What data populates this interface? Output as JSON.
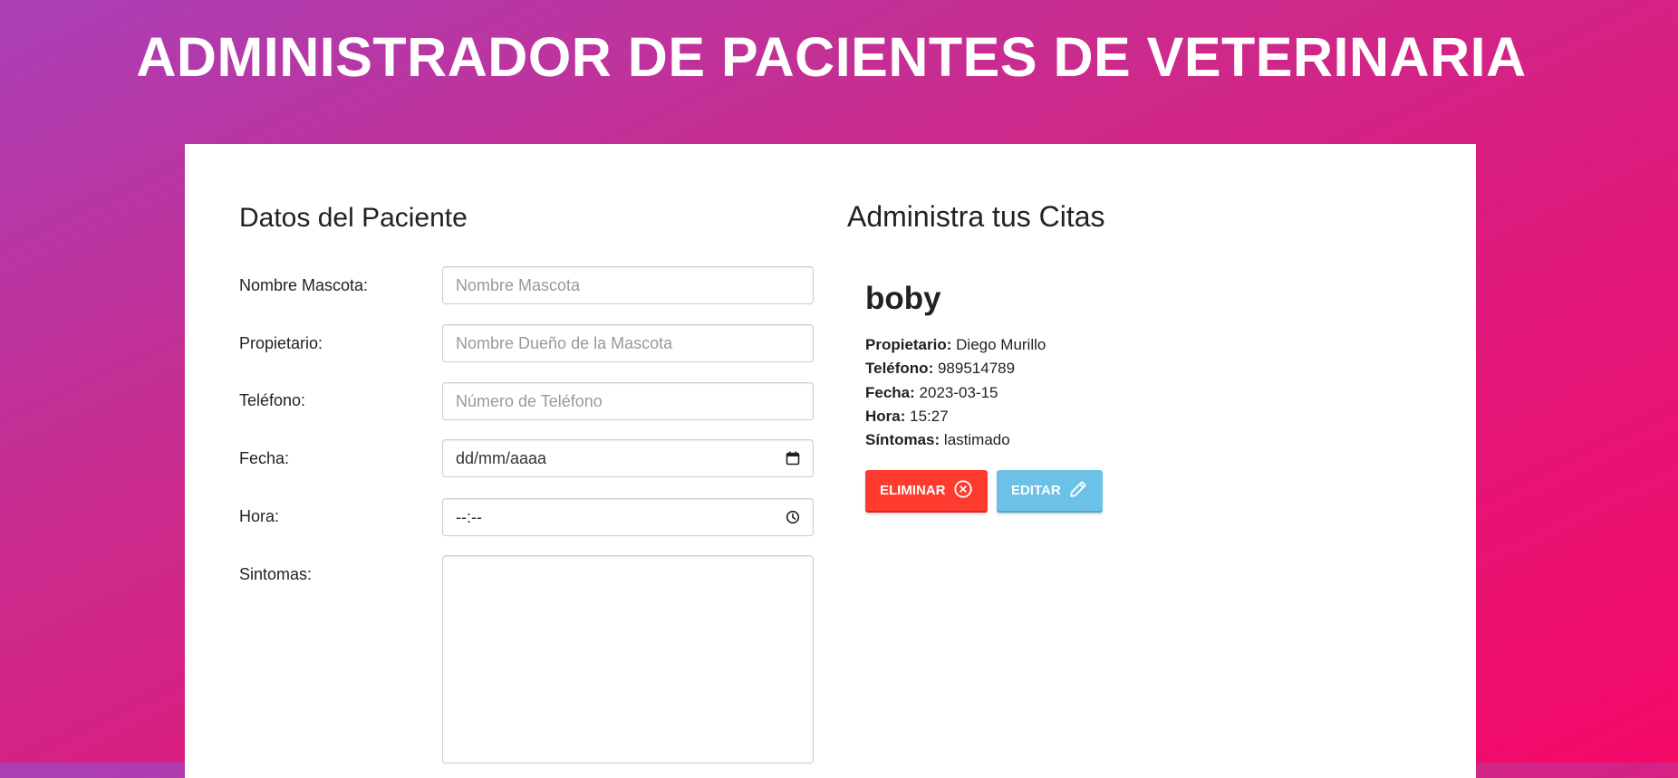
{
  "header": {
    "title": "ADMINISTRADOR DE PACIENTES DE VETERINARIA"
  },
  "form": {
    "title": "Datos del Paciente",
    "fields": {
      "pet_name": {
        "label": "Nombre Mascota:",
        "placeholder": "Nombre Mascota",
        "value": ""
      },
      "owner": {
        "label": "Propietario:",
        "placeholder": "Nombre Dueño de la Mascota",
        "value": ""
      },
      "phone": {
        "label": "Teléfono:",
        "placeholder": "Número de Teléfono",
        "value": ""
      },
      "date": {
        "label": "Fecha:",
        "display": "dd/mm/aaaa",
        "icon": "calendar-icon"
      },
      "time": {
        "label": "Hora:",
        "display": "--:--",
        "icon": "clock-icon"
      },
      "symptoms": {
        "label": "Sintomas:",
        "value": ""
      }
    }
  },
  "appointments": {
    "title": "Administra tus Citas",
    "items": [
      {
        "pet_name": "boby",
        "owner_label": "Propietario:",
        "owner": "Diego Murillo",
        "phone_label": "Teléfono:",
        "phone": "989514789",
        "date_label": "Fecha:",
        "date": "2023-03-15",
        "time_label": "Hora:",
        "time": "15:27",
        "symptoms_label": "Síntomas:",
        "symptoms": "lastimado",
        "delete_label": "ELIMINAR",
        "delete_icon": "x-circle-icon",
        "edit_label": "EDITAR",
        "edit_icon": "pencil-icon"
      }
    ]
  },
  "colors": {
    "danger": "#ff3b2f",
    "info": "#6cc1e6",
    "gradient_start": "#aa3fb6",
    "gradient_end": "#f50a68"
  }
}
